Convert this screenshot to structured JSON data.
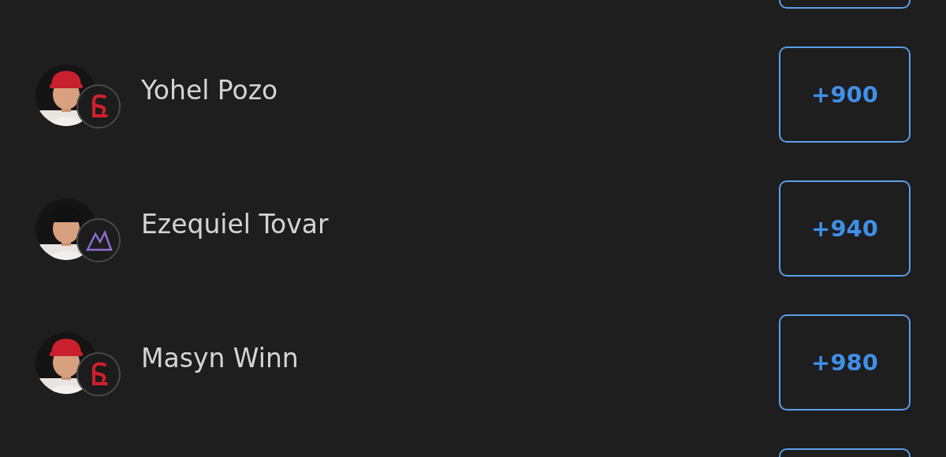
{
  "rows": [
    {
      "kind": "cut_off"
    },
    {
      "kind": "player",
      "name": "Yohel Pozo",
      "logo": {
        "kind": "red"
      },
      "odds": "+900"
    },
    {
      "kind": "player",
      "name": "Ezequiel Tovar",
      "logo": {
        "kind": "purple"
      },
      "odds": "+940"
    },
    {
      "kind": "player",
      "name": "Masyn Winn",
      "logo": {
        "kind": "red"
      },
      "odds": "+980"
    },
    {
      "kind": "cut_off"
    }
  ]
}
